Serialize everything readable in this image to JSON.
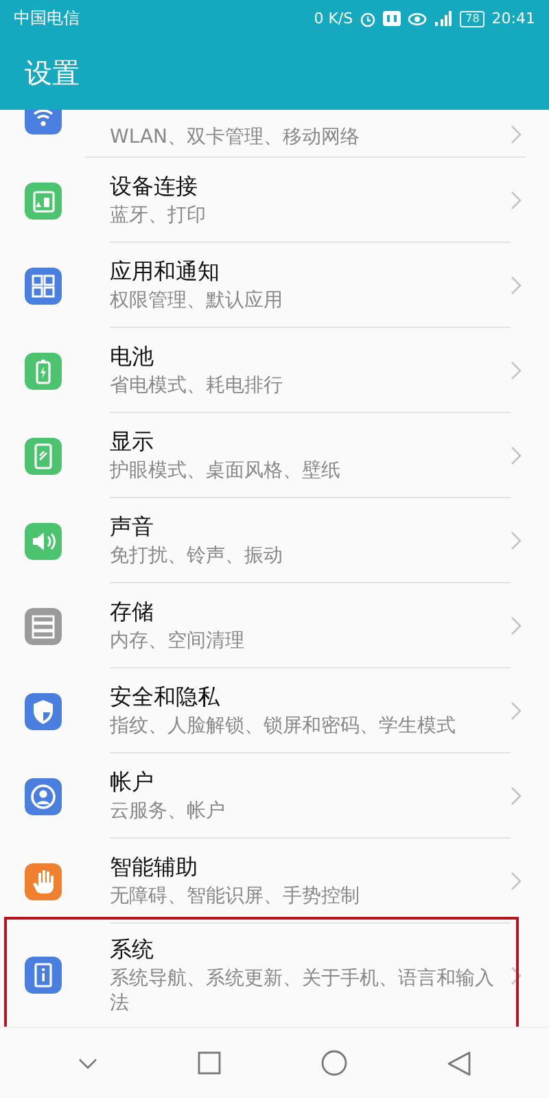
{
  "status_bar": {
    "carrier": "中国电信",
    "speed": "0 K/S",
    "battery": "78",
    "time": "20:41"
  },
  "header": {
    "title": "设置"
  },
  "items": [
    {
      "kind": "partial",
      "color": "#4a7fe0",
      "subtitle": "WLAN、双卡管理、移动网络",
      "highlighted": false
    },
    {
      "kind": "full",
      "color": "#4cc36f",
      "title": "设备连接",
      "subtitle": "蓝牙、打印",
      "highlighted": false
    },
    {
      "kind": "full",
      "color": "#4a7fe0",
      "title": "应用和通知",
      "subtitle": "权限管理、默认应用",
      "highlighted": false
    },
    {
      "kind": "full",
      "color": "#4cc36f",
      "title": "电池",
      "subtitle": "省电模式、耗电排行",
      "highlighted": false
    },
    {
      "kind": "full",
      "color": "#4cc36f",
      "title": "显示",
      "subtitle": "护眼模式、桌面风格、壁纸",
      "highlighted": false
    },
    {
      "kind": "full",
      "color": "#4cc36f",
      "title": "声音",
      "subtitle": "免打扰、铃声、振动",
      "highlighted": false
    },
    {
      "kind": "full",
      "color": "#9b9b9b",
      "title": "存储",
      "subtitle": "内存、空间清理",
      "highlighted": false
    },
    {
      "kind": "full",
      "color": "#4a7fe0",
      "title": "安全和隐私",
      "subtitle": "指纹、人脸解锁、锁屏和密码、学生模式",
      "highlighted": false
    },
    {
      "kind": "full",
      "color": "#4a7fe0",
      "title": "帐户",
      "subtitle": "云服务、帐户",
      "highlighted": false
    },
    {
      "kind": "full",
      "color": "#f07f2e",
      "title": "智能辅助",
      "subtitle": "无障碍、智能识屏、手势控制",
      "highlighted": false
    },
    {
      "kind": "full",
      "color": "#4a7fe0",
      "title": "系统",
      "subtitle": "系统导航、系统更新、关于手机、语言和输入法",
      "highlighted": true
    }
  ]
}
